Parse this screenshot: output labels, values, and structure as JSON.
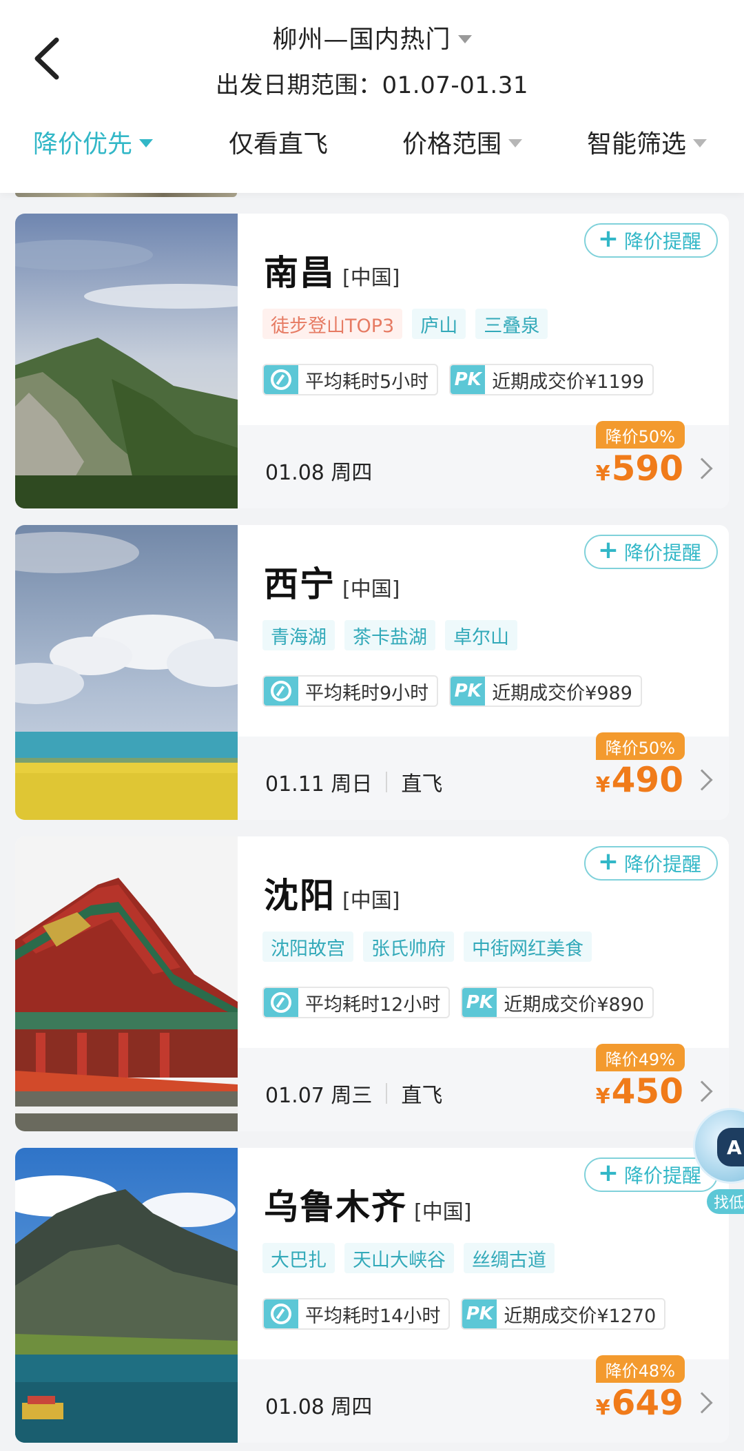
{
  "header": {
    "title": "柳州—国内热门",
    "subtitle": "出发日期范围：01.07-01.31"
  },
  "filters": [
    {
      "label": "降价优先",
      "active": true,
      "has_caret": true
    },
    {
      "label": "仅看直飞",
      "active": false,
      "has_caret": false
    },
    {
      "label": "价格范围",
      "active": false,
      "has_caret": true
    },
    {
      "label": "智能筛选",
      "active": false,
      "has_caret": true
    }
  ],
  "remind_label": "降价提醒",
  "avg_time_prefix": "平均耗时",
  "recent_price_prefix": "近期成交价",
  "pk_icon_text": "PK",
  "currency_symbol": "¥",
  "cards": [
    {
      "city": "南昌",
      "country": "[中国]",
      "tags": [
        {
          "text": "徒步登山TOP3",
          "hot": true
        },
        {
          "text": "庐山",
          "hot": false
        },
        {
          "text": "三叠泉",
          "hot": false
        }
      ],
      "avg_time": "平均耗时5小时",
      "recent_price": "近期成交价¥1199",
      "date": "01.08 周四",
      "direct": "",
      "discount": "降价50%",
      "price": "590"
    },
    {
      "city": "西宁",
      "country": "[中国]",
      "tags": [
        {
          "text": "青海湖",
          "hot": false
        },
        {
          "text": "茶卡盐湖",
          "hot": false
        },
        {
          "text": "卓尔山",
          "hot": false
        }
      ],
      "avg_time": "平均耗时9小时",
      "recent_price": "近期成交价¥989",
      "date": "01.11 周日",
      "direct": "直飞",
      "discount": "降价50%",
      "price": "490"
    },
    {
      "city": "沈阳",
      "country": "[中国]",
      "tags": [
        {
          "text": "沈阳故宫",
          "hot": false
        },
        {
          "text": "张氏帅府",
          "hot": false
        },
        {
          "text": "中街网红美食",
          "hot": false
        }
      ],
      "avg_time": "平均耗时12小时",
      "recent_price": "近期成交价¥890",
      "date": "01.07 周三",
      "direct": "直飞",
      "discount": "降价49%",
      "price": "450"
    },
    {
      "city": "乌鲁木齐",
      "country": "[中国]",
      "tags": [
        {
          "text": "大巴扎",
          "hot": false
        },
        {
          "text": "天山大峡谷",
          "hot": false
        },
        {
          "text": "丝绸古道",
          "hot": false
        }
      ],
      "avg_time": "平均耗时14小时",
      "recent_price": "近期成交价¥1270",
      "date": "01.08 周四",
      "direct": "",
      "discount": "降价48%",
      "price": "649"
    }
  ],
  "ai_assistant": {
    "face_text": "A",
    "label": "找低"
  },
  "colors": {
    "accent": "#32b7c7",
    "price": "#f07b1a",
    "discount_bg": "#f39a2e",
    "hot_tag": "#e67a62"
  }
}
